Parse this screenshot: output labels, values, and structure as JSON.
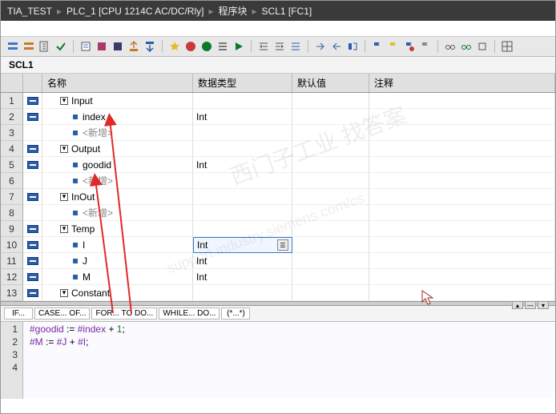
{
  "breadcrumb": {
    "project": "TIA_TEST",
    "plc": "PLC_1 [CPU 1214C AC/DC/Rly]",
    "blocks": "程序块",
    "fc": "SCL1 [FC1]"
  },
  "blockTitle": "SCL1",
  "columns": {
    "name": "名称",
    "type": "数据类型",
    "default": "默认值",
    "comment": "注释"
  },
  "rows": [
    {
      "n": "1",
      "icon": "io",
      "nameClass": "indent1",
      "expand": true,
      "label": "Input",
      "type": "",
      "def": ""
    },
    {
      "n": "2",
      "icon": "io",
      "nameClass": "indent2",
      "bullet": true,
      "label": "index",
      "type": "Int",
      "def": ""
    },
    {
      "n": "3",
      "icon": "",
      "nameClass": "indent2",
      "bullet": true,
      "label": "<新增>",
      "ph": true,
      "type": "",
      "def": ""
    },
    {
      "n": "4",
      "icon": "io",
      "nameClass": "indent1",
      "expand": true,
      "label": "Output",
      "type": "",
      "def": ""
    },
    {
      "n": "5",
      "icon": "io",
      "nameClass": "indent2",
      "bullet": true,
      "label": "goodid",
      "type": "Int",
      "def": ""
    },
    {
      "n": "6",
      "icon": "",
      "nameClass": "indent2",
      "bullet": true,
      "label": "<新增>",
      "ph": true,
      "type": "",
      "def": ""
    },
    {
      "n": "7",
      "icon": "io",
      "nameClass": "indent1",
      "expand": true,
      "label": "InOut",
      "type": "",
      "def": ""
    },
    {
      "n": "8",
      "icon": "",
      "nameClass": "indent2",
      "bullet": true,
      "label": "<新增>",
      "ph": true,
      "type": "",
      "def": ""
    },
    {
      "n": "9",
      "icon": "io",
      "nameClass": "indent1",
      "expand": true,
      "label": "Temp",
      "type": "",
      "def": ""
    },
    {
      "n": "10",
      "icon": "io",
      "nameClass": "indent2",
      "bullet": true,
      "label": "I",
      "type": "Int",
      "def": "",
      "sel": true
    },
    {
      "n": "11",
      "icon": "io",
      "nameClass": "indent2",
      "bullet": true,
      "label": "J",
      "type": "Int",
      "def": ""
    },
    {
      "n": "12",
      "icon": "io",
      "nameClass": "indent2",
      "bullet": true,
      "label": "M",
      "type": "Int",
      "def": ""
    },
    {
      "n": "13",
      "icon": "io",
      "nameClass": "indent1",
      "expand": true,
      "label": "Constant",
      "type": "",
      "def": ""
    }
  ],
  "snippets": {
    "if": "IF...",
    "case": "CASE... OF...",
    "for": "FOR... TO DO...",
    "while": "WHILE... DO...",
    "repeat": "(*...*)"
  },
  "code": {
    "l1_v1": "#goodid",
    "l1_assign": " := ",
    "l1_v2": "#index",
    "l1_op": " + ",
    "l1_n": "1",
    "l1_end": ";",
    "l2_v1": "#M",
    "l2_assign": " := ",
    "l2_v2": "#J",
    "l2_op": " + ",
    "l2_v3": "#I",
    "l2_end": ";"
  },
  "lineNumbers": [
    "1",
    "2",
    "3",
    "4"
  ],
  "watermarks": {
    "a": "西门子工业  找答案",
    "b": "support.industry.siemens.com/cs"
  }
}
